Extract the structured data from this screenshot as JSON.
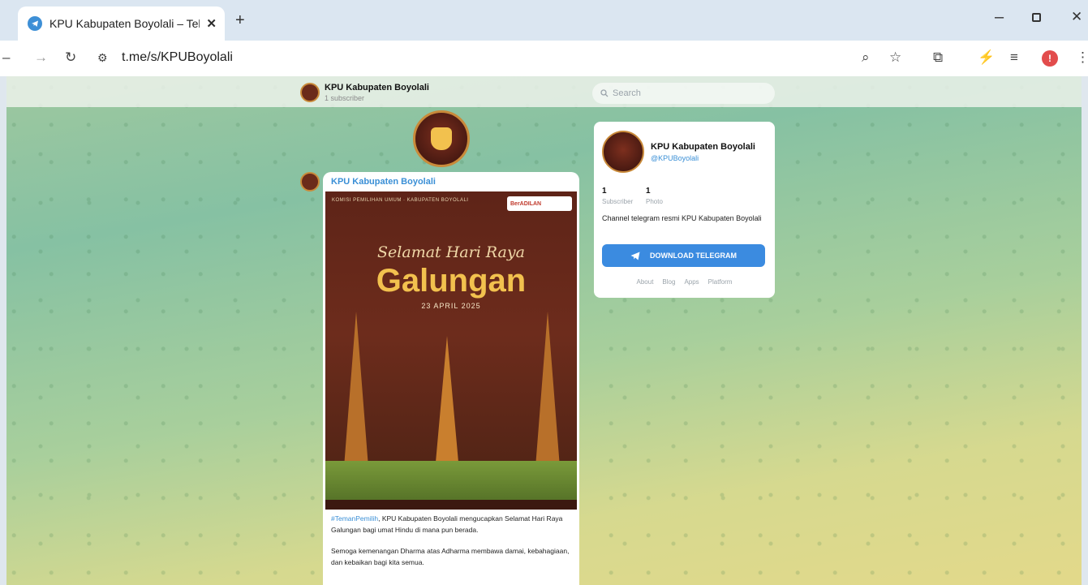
{
  "browser": {
    "tab_title": "KPU Kabupaten Boyolali – Tele",
    "url": "t.me/s/KPUBoyolali",
    "profile_initial": "!"
  },
  "channel": {
    "name": "KPU Kabupaten Boyolali",
    "subscriber_line": "1 subscriber",
    "handle": "@KPUBoyolali",
    "description": "Channel telegram resmi KPU Kabupaten Boyolali"
  },
  "search": {
    "placeholder": "Search"
  },
  "post": {
    "author": "KPU Kabupaten Boyolali",
    "poster": {
      "org": "KOMISI PEMILIHAN UMUM · KABUPATEN BOYOLALI",
      "badge": "BerADILAN",
      "script_title": "Selamat Hari Raya",
      "main_title": "Galungan",
      "date": "23 APRIL 2025"
    },
    "hashtag": "#TemanPemilih",
    "text1": ", KPU Kabupaten Boyolali mengucapkan Selamat Hari Raya Galungan bagi umat Hindu di mana pun berada.",
    "text2": "Semoga kemenangan Dharma atas Adharma membawa damai, kebahagiaan, dan kebaikan bagi kita semua."
  },
  "stats": [
    {
      "value": "1",
      "label": "Subscriber"
    },
    {
      "value": "1",
      "label": "Photo"
    }
  ],
  "download_button": "DOWNLOAD TELEGRAM",
  "footer_links": [
    "About",
    "Blog",
    "Apps",
    "Platform"
  ],
  "colors": {
    "telegram_blue": "#3b8be0",
    "link_blue": "#3a8fd6",
    "poster_bg": "#5e2418",
    "gold": "#f2c14e"
  }
}
